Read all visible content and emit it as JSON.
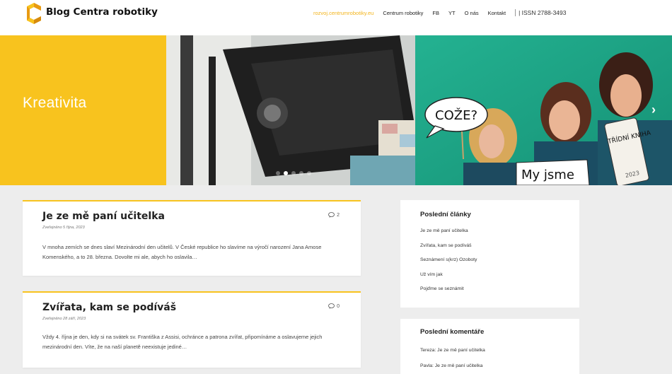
{
  "site": {
    "title": "Blog Centra robotiky"
  },
  "nav": {
    "items": [
      {
        "label": "rozvoj.centrumrobotiky.eu",
        "active": true
      },
      {
        "label": "Centrum robotiky",
        "active": false
      },
      {
        "label": "FB",
        "active": false
      },
      {
        "label": "YT",
        "active": false
      },
      {
        "label": "O nás",
        "active": false
      },
      {
        "label": "Kontakt",
        "active": false
      }
    ],
    "issn": "| ISSN 2788-3493"
  },
  "hero": {
    "title": "Kreativita",
    "slide_count": 5,
    "active_slide": 1,
    "signs": [
      "COŽE?",
      "My jsme",
      "TŘÍDNÍ KNIHA",
      "2023"
    ],
    "accent_color": "#f8c31e"
  },
  "posts": [
    {
      "title": "Je ze mě paní učitelka",
      "date": "Zveřejněno 5 října, 2023",
      "comments": "2",
      "excerpt": "V mnoha zemích se dnes slaví Mezinárodní den učitelů. V České republice ho slavíme na výročí narození Jana Amose Komenského, a to 28. března. Dovolte mi ale, abych ho oslavila…"
    },
    {
      "title": "Zvířata, kam se podíváš",
      "date": "Zveřejněno 28 září, 2023",
      "comments": "0",
      "excerpt": "Vždy 4. října je den, kdy si na svátek sv. Františka z Assisi, ochránce a patrona zvířat, připomínáme a oslavujeme jejich mezinárodní den. Víte, že na naší planetě neexistuje jediné…"
    }
  ],
  "sidebar": {
    "recent_posts": {
      "title": "Poslední články",
      "items": [
        "Je ze mě paní učitelka",
        "Zvířata, kam se podíváš",
        "Seznámení s(krz) Ozoboty",
        "Už vím jak",
        "Pojďme se seznámit"
      ]
    },
    "recent_comments": {
      "title": "Poslední komentáře",
      "items": [
        "Tereza: Je ze mě paní učitelka",
        "Pavla: Je ze mě paní učitelka"
      ]
    }
  }
}
